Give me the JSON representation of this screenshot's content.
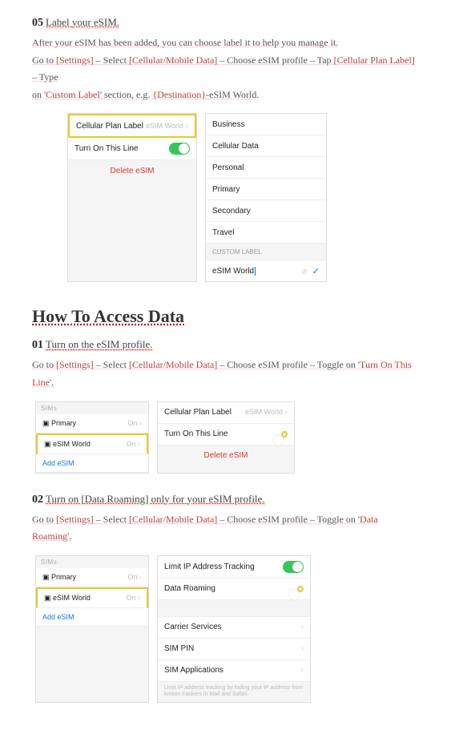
{
  "step05": {
    "num": "05",
    "title": "Label your eSIM.",
    "line1_a": "After your eSIM has been added, you can choose label it to help you manage it.",
    "line2_a": "Go to ",
    "line2_b": "[Settings]",
    "line2_c": " – Select ",
    "line2_d": "[Cellular/Mobile Data]",
    "line2_e": " – Choose eSIM profile – Tap ",
    "line2_f": "[Cellular Plan Label]",
    "line2_g": " – Type",
    "line3_a": "on '",
    "line3_b": "Custom Label",
    "line3_c": "' section, e.g. ",
    "line3_d": "{Destination}",
    "line3_e": "-eSIM World."
  },
  "panel05": {
    "left": {
      "row1_label": "Cellular Plan Label",
      "row1_val": "eSIM World",
      "row2_label": "Turn On This Line",
      "delete": "Delete eSIM"
    },
    "right": {
      "opts": [
        "Business",
        "Cellular Data",
        "Personal",
        "Primary",
        "Secondary",
        "Travel"
      ],
      "custom_hdr": "CUSTOM LABEL",
      "custom_val": "eSIM World"
    }
  },
  "sectionTitle": "How To Access Data",
  "step01": {
    "num": "01",
    "title": "Turn on the eSIM profile.",
    "line_a": "Go to ",
    "line_b": "[Settings]",
    "line_c": " – Select ",
    "line_d": "[Cellular/Mobile Data]",
    "line_e": " – Choose eSIM profile – Toggle on '",
    "line_f": "Turn On This Line",
    "line_g": "'."
  },
  "panel01": {
    "left": {
      "hdr": "SIMs",
      "primary": "Primary",
      "on": "On",
      "esim": "eSIM World",
      "add": "Add eSIM"
    },
    "right": {
      "row1_label": "Cellular Plan Label",
      "row1_val": "eSIM World",
      "row2_label": "Turn On This Line",
      "delete": "Delete eSIM"
    }
  },
  "step02": {
    "num": "02",
    "title": "Turn on [Data Roaming] only for your eSIM profile.",
    "line_a": "Go to ",
    "line_b": "[Settings]",
    "line_c": " – Select ",
    "line_d": "[Cellular/Mobile Data]",
    "line_e": " – Choose eSIM profile – Toggle on '",
    "line_f": "Data Roaming",
    "line_g": "'."
  },
  "panel02": {
    "left": {
      "hdr": "SIMs",
      "primary": "Primary",
      "on": "On",
      "esim": "eSIM World",
      "add": "Add eSIM"
    },
    "right": {
      "r1": "Limit IP Address Tracking",
      "r2": "Data Roaming",
      "r3": "Carrier Services",
      "r4": "SIM PIN",
      "r5": "SIM Applications",
      "note": "Limit IP address tracking by hiding your IP address from known trackers in Mail and Safari."
    }
  }
}
